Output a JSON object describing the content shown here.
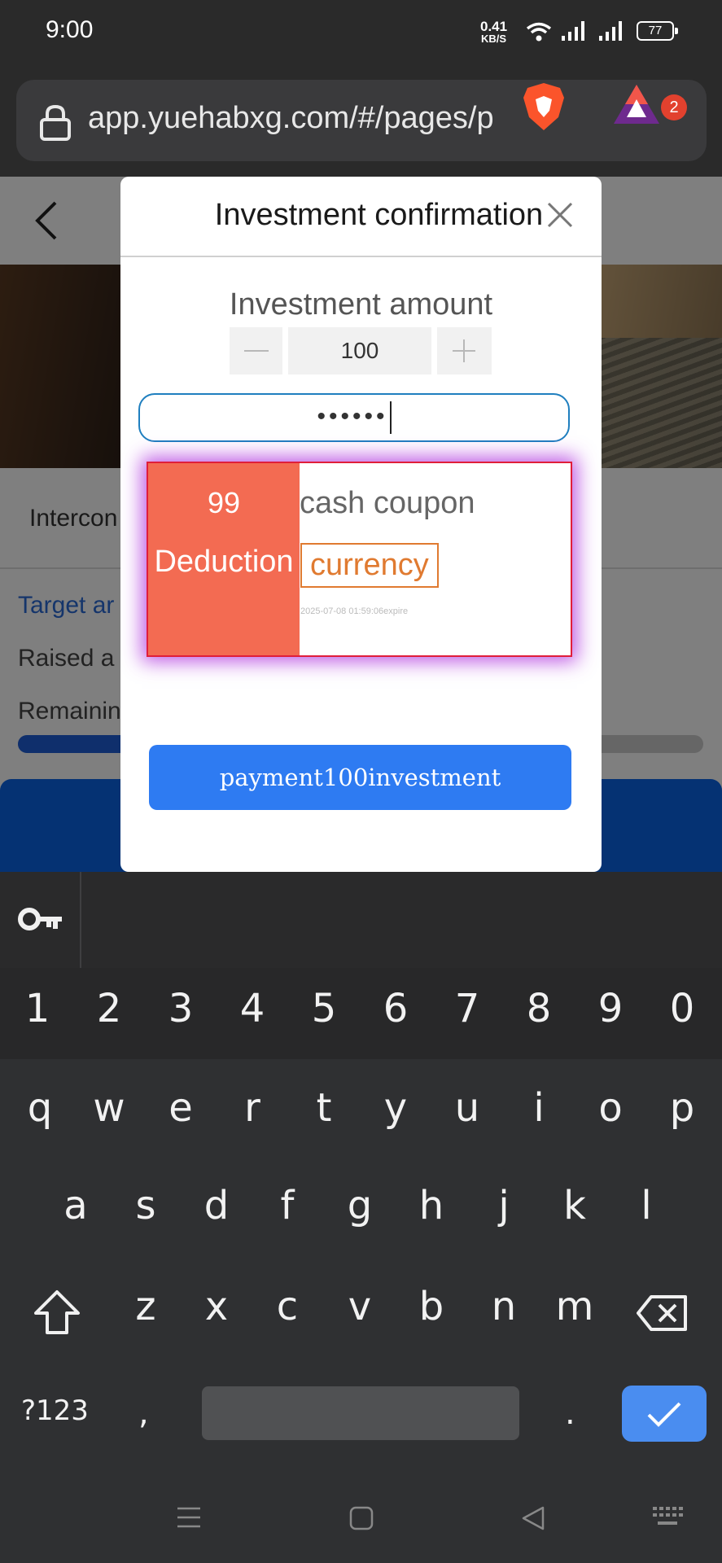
{
  "status_bar": {
    "time": "9:00",
    "net_speed_value": "0.41",
    "net_speed_unit": "KB/S",
    "battery": "77"
  },
  "browser": {
    "url": "app.yuehabxg.com/#/pages/p",
    "rewards_badge": "2"
  },
  "background_page": {
    "hotel_name": "Intercon",
    "target_label": "Target ar",
    "raised_label": "Raised a",
    "remaining_label": "Remainin",
    "progress_fraction": 0.2
  },
  "modal": {
    "title": "Investment confirmation",
    "amount_label": "Investment amount",
    "amount_value": "100",
    "password_mask": "••••••",
    "coupon": {
      "amount": "99",
      "deduction_label": "Deduction",
      "type": "cash coupon",
      "currency_tag": "currency",
      "expire": "2025-07-08 01:59:06expire"
    },
    "pay_button": "payment100investment"
  },
  "keyboard": {
    "number_row": [
      "1",
      "2",
      "3",
      "4",
      "5",
      "6",
      "7",
      "8",
      "9",
      "0"
    ],
    "row1": [
      "q",
      "w",
      "e",
      "r",
      "t",
      "y",
      "u",
      "i",
      "o",
      "p"
    ],
    "row2": [
      "a",
      "s",
      "d",
      "f",
      "g",
      "h",
      "j",
      "k",
      "l"
    ],
    "row3": [
      "z",
      "x",
      "c",
      "v",
      "b",
      "n",
      "m"
    ],
    "symbols_key": "?123",
    "comma_key": ",",
    "period_key": "."
  },
  "colors": {
    "accent_blue": "#2e7bf2",
    "coupon_red": "#f36b52",
    "currency_orange": "#e07a30",
    "highlight_purple": "#aa28dc"
  }
}
